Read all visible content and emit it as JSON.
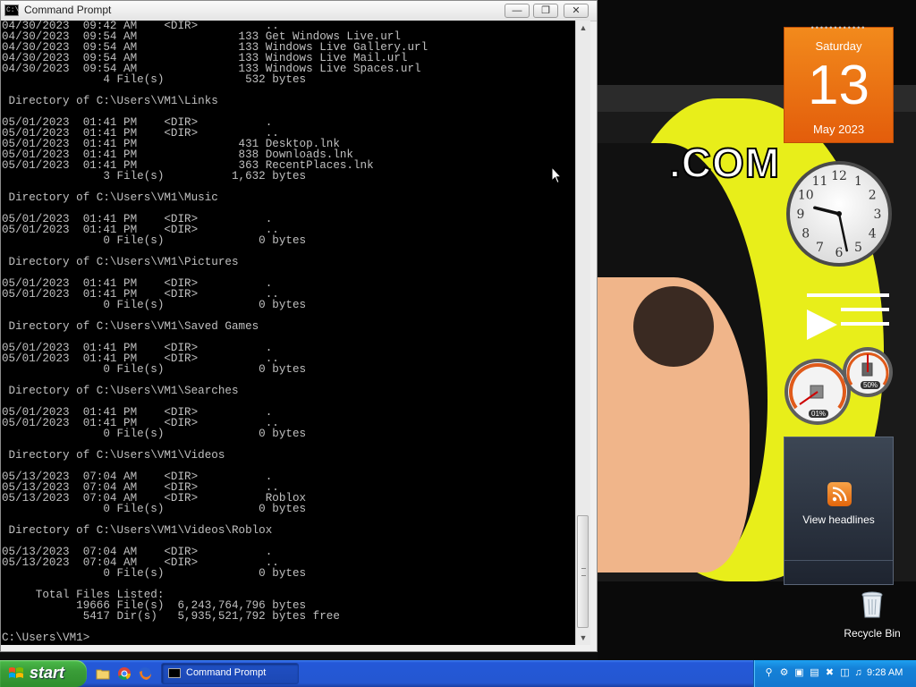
{
  "window": {
    "title": "Command Prompt",
    "icon_text": "C:\\",
    "minimize_icon": "minimize-icon",
    "maximize_icon": "restore-icon",
    "close_icon": "close-icon"
  },
  "console": {
    "lines": [
      "04/30/2023  09:42 AM    <DIR>          ..",
      "04/30/2023  09:54 AM               133 Get Windows Live.url",
      "04/30/2023  09:54 AM               133 Windows Live Gallery.url",
      "04/30/2023  09:54 AM               133 Windows Live Mail.url",
      "04/30/2023  09:54 AM               133 Windows Live Spaces.url",
      "               4 File(s)            532 bytes",
      "",
      " Directory of C:\\Users\\VM1\\Links",
      "",
      "05/01/2023  01:41 PM    <DIR>          .",
      "05/01/2023  01:41 PM    <DIR>          ..",
      "05/01/2023  01:41 PM               431 Desktop.lnk",
      "05/01/2023  01:41 PM               838 Downloads.lnk",
      "05/01/2023  01:41 PM               363 RecentPlaces.lnk",
      "               3 File(s)          1,632 bytes",
      "",
      " Directory of C:\\Users\\VM1\\Music",
      "",
      "05/01/2023  01:41 PM    <DIR>          .",
      "05/01/2023  01:41 PM    <DIR>          ..",
      "               0 File(s)              0 bytes",
      "",
      " Directory of C:\\Users\\VM1\\Pictures",
      "",
      "05/01/2023  01:41 PM    <DIR>          .",
      "05/01/2023  01:41 PM    <DIR>          ..",
      "               0 File(s)              0 bytes",
      "",
      " Directory of C:\\Users\\VM1\\Saved Games",
      "",
      "05/01/2023  01:41 PM    <DIR>          .",
      "05/01/2023  01:41 PM    <DIR>          ..",
      "               0 File(s)              0 bytes",
      "",
      " Directory of C:\\Users\\VM1\\Searches",
      "",
      "05/01/2023  01:41 PM    <DIR>          .",
      "05/01/2023  01:41 PM    <DIR>          ..",
      "               0 File(s)              0 bytes",
      "",
      " Directory of C:\\Users\\VM1\\Videos",
      "",
      "05/13/2023  07:04 AM    <DIR>          .",
      "05/13/2023  07:04 AM    <DIR>          ..",
      "05/13/2023  07:04 AM    <DIR>          Roblox",
      "               0 File(s)              0 bytes",
      "",
      " Directory of C:\\Users\\VM1\\Videos\\Roblox",
      "",
      "05/13/2023  07:04 AM    <DIR>          .",
      "05/13/2023  07:04 AM    <DIR>          ..",
      "               0 File(s)              0 bytes",
      "",
      "     Total Files Listed:",
      "           19666 File(s)  6,243,764,796 bytes",
      "            5417 Dir(s)   5,935,521,792 bytes free",
      "",
      "C:\\Users\\VM1>"
    ]
  },
  "gadgets": {
    "calendar": {
      "weekday": "Saturday",
      "day": "13",
      "month_year": "May 2023"
    },
    "clock": {
      "hour": 9,
      "minute": 28,
      "numerals": [
        "12",
        "1",
        "2",
        "3",
        "4",
        "5",
        "6",
        "7",
        "8",
        "9",
        "10",
        "11"
      ]
    },
    "meter": {
      "cpu": "01%",
      "memory": "50%"
    },
    "feed": {
      "label": "View headlines"
    }
  },
  "desktop": {
    "wallpaper_text": ".COM",
    "recycle_bin": "Recycle Bin"
  },
  "taskbar": {
    "start_label": "start",
    "task_label": "Command Prompt",
    "time": "9:28 AM"
  },
  "colors": {
    "console_bg": "#000000",
    "console_fg": "#c0c0c0",
    "calendar": "#e8660f",
    "taskbar": "#2458d8"
  }
}
